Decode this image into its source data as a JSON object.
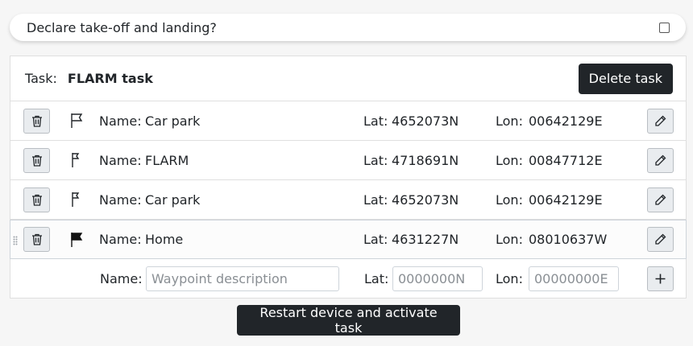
{
  "declare": {
    "label": "Declare take-off and landing?",
    "checked": false
  },
  "task": {
    "label": "Task:",
    "name": "FLARM task",
    "delete_label": "Delete task"
  },
  "waypoint_labels": {
    "name": "Name:",
    "lat": "Lat:",
    "lon": "Lon:"
  },
  "waypoints": [
    {
      "name": "Car park",
      "lat": "4652073N",
      "lon": "00642129E",
      "icon": "flag-outline-icon"
    },
    {
      "name": "FLARM",
      "lat": "4718691N",
      "lon": "00847712E",
      "icon": "turnpoint-flag-icon"
    },
    {
      "name": "Car park",
      "lat": "4652073N",
      "lon": "00642129E",
      "icon": "turnpoint-flag-icon"
    },
    {
      "name": "Home",
      "lat": "4631227N",
      "lon": "08010637W",
      "icon": "flag-filled-icon"
    }
  ],
  "new_waypoint": {
    "name_placeholder": "Waypoint description",
    "lat_placeholder": "0000000N",
    "lon_placeholder": "00000000E",
    "add_icon": "plus-icon"
  },
  "restart_label": "Restart device and activate task",
  "colors": {
    "dark_button": "#212529",
    "background": "#f6f6f6"
  }
}
